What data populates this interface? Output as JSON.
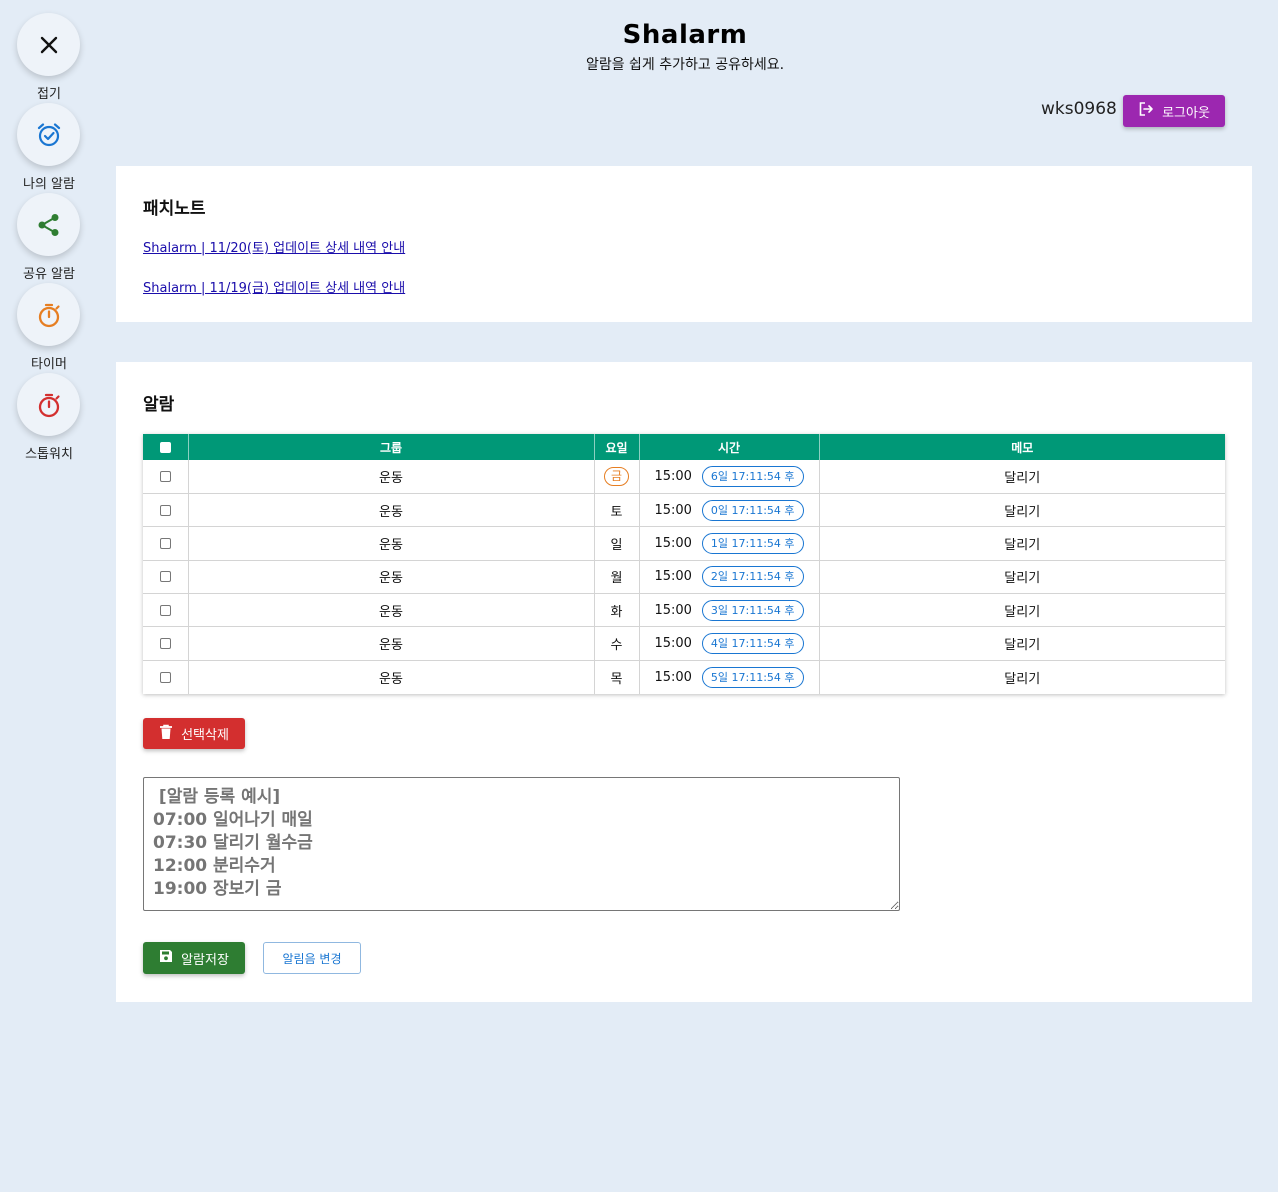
{
  "sidebar": {
    "items": [
      {
        "label": "접기",
        "icon": "close-icon",
        "color": "#111111"
      },
      {
        "label": "나의 알람",
        "icon": "alarm-check-icon",
        "color": "#1976d2"
      },
      {
        "label": "공유 알람",
        "icon": "share-icon",
        "color": "#2e7d32"
      },
      {
        "label": "타이머",
        "icon": "timer-icon",
        "color": "#e67e22"
      },
      {
        "label": "스톱워치",
        "icon": "stopwatch-icon",
        "color": "#d32f2f"
      }
    ]
  },
  "header": {
    "title": "Shalarm",
    "subtitle": "알람을 쉽게 추가하고 공유하세요.",
    "username": "wks0968",
    "logout_label": "로그아웃",
    "logout_color": "#9c27b0"
  },
  "patch_notes": {
    "title": "패치노트",
    "links": [
      "Shalarm | 11/20(토) 업데이트 상세 내역 안내",
      "Shalarm | 11/19(금) 업데이트 상세 내역 안내"
    ]
  },
  "alarms": {
    "title": "알람",
    "columns": [
      "그룹",
      "요일",
      "시간",
      "메모"
    ],
    "header_color": "#009877",
    "rows": [
      {
        "group": "운동",
        "day": "금",
        "day_highlight": true,
        "time": "15:00",
        "remain": "6일 17:11:54 후",
        "memo": "달리기"
      },
      {
        "group": "운동",
        "day": "토",
        "day_highlight": false,
        "time": "15:00",
        "remain": "0일 17:11:54 후",
        "memo": "달리기"
      },
      {
        "group": "운동",
        "day": "일",
        "day_highlight": false,
        "time": "15:00",
        "remain": "1일 17:11:54 후",
        "memo": "달리기"
      },
      {
        "group": "운동",
        "day": "월",
        "day_highlight": false,
        "time": "15:00",
        "remain": "2일 17:11:54 후",
        "memo": "달리기"
      },
      {
        "group": "운동",
        "day": "화",
        "day_highlight": false,
        "time": "15:00",
        "remain": "3일 17:11:54 후",
        "memo": "달리기"
      },
      {
        "group": "운동",
        "day": "수",
        "day_highlight": false,
        "time": "15:00",
        "remain": "4일 17:11:54 후",
        "memo": "달리기"
      },
      {
        "group": "운동",
        "day": "목",
        "day_highlight": false,
        "time": "15:00",
        "remain": "5일 17:11:54 후",
        "memo": "달리기"
      }
    ],
    "delete_label": "선택삭제",
    "textarea_placeholder": " [알람 등록 예시]\n07:00 일어나기 매일\n07:30 달리기 월수금\n12:00 분리수거\n19:00 장보기 금",
    "save_label": "알람저장",
    "sound_label": "알림음 변경"
  }
}
